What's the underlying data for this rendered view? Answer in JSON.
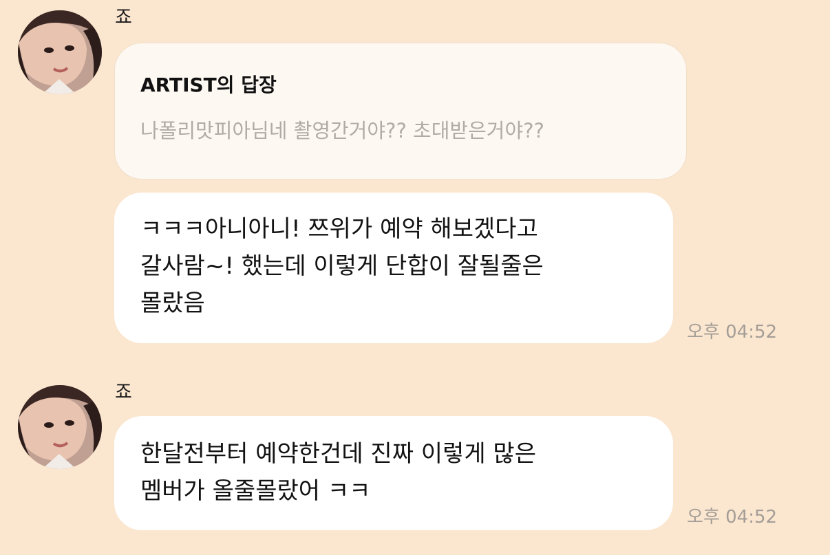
{
  "messages": [
    {
      "sender": "죠",
      "avatar_icon": "profile-photo",
      "reply": {
        "title": "ARTIST의 답장",
        "preview": "나폴리맛피아님네 촬영간거야?? 초대받은거야??"
      },
      "lines": [
        "ㅋㅋㅋ아니아니! 쯔위가 예약 해보겠다고",
        "갈사람~! 했는데 이렇게 단합이 잘될줄은",
        "몰랐음"
      ],
      "time": "오후 04:52"
    },
    {
      "sender": "죠",
      "avatar_icon": "profile-photo",
      "lines": [
        "한달전부터 예약한건데 진짜 이렇게 많은",
        "멤버가 올줄몰랐어 ㅋㅋ"
      ],
      "time": "오후 04:52"
    }
  ],
  "colors": {
    "background": "#fbe6cf",
    "bubble": "#ffffff",
    "reply_bubble": "#fdf8f2",
    "time_text": "#a39d97",
    "preview_text": "#b0aba6"
  }
}
